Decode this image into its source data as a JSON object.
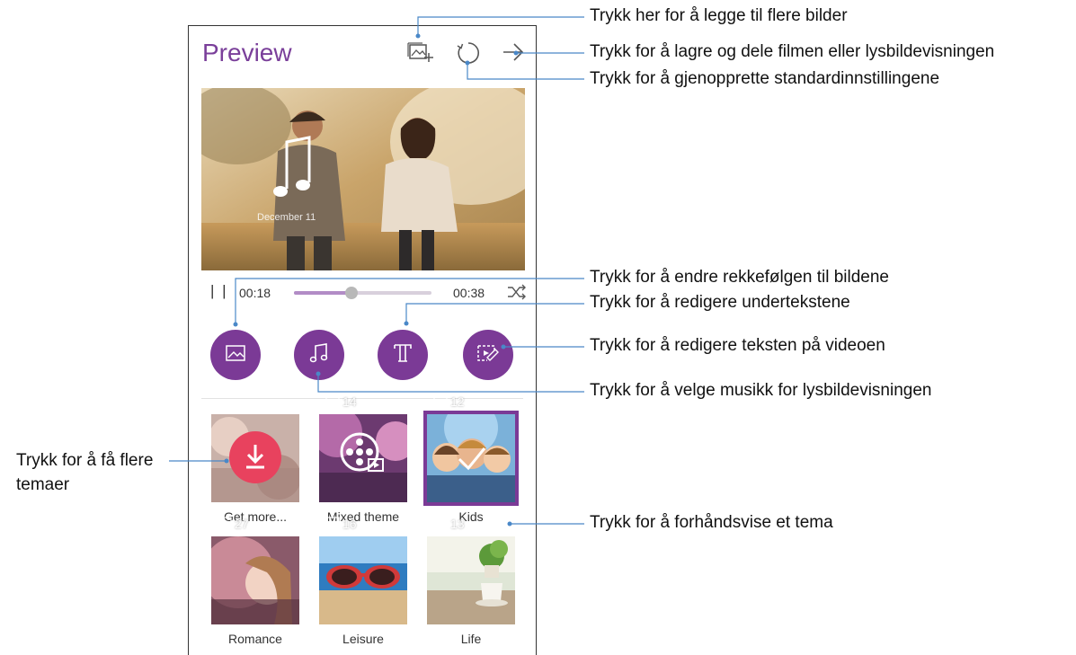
{
  "app": {
    "title": "Preview",
    "preview": {
      "date_caption": "December 11"
    },
    "player": {
      "pause_label": "| |",
      "elapsed": "00:18",
      "total": "00:38",
      "progress": 0.42
    },
    "tools": [
      {
        "name": "reorder-photos",
        "icon": "image-icon"
      },
      {
        "name": "music",
        "icon": "music-note-icon"
      },
      {
        "name": "subtitles",
        "icon": "text-t-icon"
      },
      {
        "name": "video-text",
        "icon": "video-edit-icon"
      }
    ],
    "themes": [
      {
        "label": "Get more...",
        "count": ""
      },
      {
        "label": "Mixed theme",
        "count": "14"
      },
      {
        "label": "Kids",
        "count": "12",
        "selected": true
      },
      {
        "label": "Romance",
        "count": "27"
      },
      {
        "label": "Leisure",
        "count": "16"
      },
      {
        "label": "Life",
        "count": "13"
      }
    ]
  },
  "callouts": {
    "add_photos": "Trykk her for å legge til flere bilder",
    "save_share": "Trykk for å lagre og dele filmen eller lysbildevisningen",
    "reset": "Trykk for å gjenopprette standardinnstillingene",
    "reorder": "Trykk for å endre rekkefølgen til bildene",
    "subtitles": "Trykk for å redigere undertekstene",
    "video_text": "Trykk for å redigere teksten på videoen",
    "music": "Trykk for å velge musikk for lysbildevisningen",
    "more_themes": "Trykk for å få flere temaer",
    "preview_theme": "Trykk for å forhåndsvise et tema"
  },
  "colors": {
    "accent": "#7b3a96",
    "title": "#7a3f9a",
    "download": "#e8425e"
  }
}
